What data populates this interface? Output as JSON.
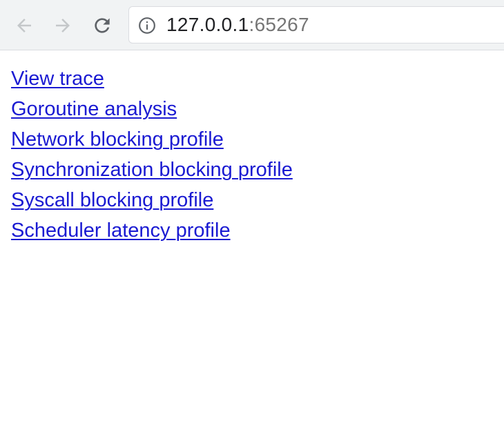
{
  "browser": {
    "back_icon": "arrow-left-icon",
    "forward_icon": "arrow-right-icon",
    "reload_icon": "reload-icon",
    "site_info_icon": "info-circle-icon",
    "url_host": "127.0.0.1",
    "url_port": ":65267",
    "colors": {
      "toolbar_bg": "#f1f3f4",
      "icon_disabled": "#bdc1c6",
      "icon_active": "#5f6368",
      "link": "#1a1ad2"
    }
  },
  "page": {
    "links": [
      {
        "label": "View trace"
      },
      {
        "label": "Goroutine analysis"
      },
      {
        "label": "Network blocking profile"
      },
      {
        "label": "Synchronization blocking profile"
      },
      {
        "label": "Syscall blocking profile"
      },
      {
        "label": "Scheduler latency profile"
      }
    ]
  }
}
